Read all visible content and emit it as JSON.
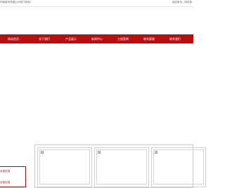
{
  "topbar": {
    "welcome_text": "环新股份有限公司官方网站！",
    "links": [
      "返回首页",
      "网页首"
    ]
  },
  "nav": {
    "items": [
      "网站首页",
      "关于我们",
      "产品展示",
      "新闻中心",
      "工程案例",
      "联系客服",
      "联系我们"
    ]
  },
  "sidebar": {
    "items": [
      "全部目录",
      "全部目录"
    ]
  },
  "gallery": {
    "cards": [
      {
        "image": "broken-image-icon"
      },
      {
        "image": "broken-image-icon"
      },
      {
        "image": "broken-image-icon"
      }
    ]
  },
  "colors": {
    "nav_bg": "#b90d10",
    "nav_text": "#ffffff",
    "side_border": "#a40d0d"
  }
}
